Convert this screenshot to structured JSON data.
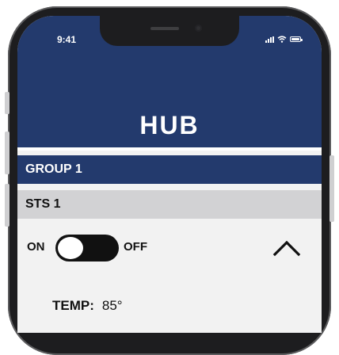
{
  "status_bar": {
    "time": "9:41",
    "icons": [
      "signal-icon",
      "wifi-icon",
      "battery-icon"
    ]
  },
  "header": {
    "title": "HUB",
    "background": "#233a6d"
  },
  "group": {
    "label": "GROUP 1"
  },
  "device": {
    "label": "STS 1"
  },
  "power_toggle": {
    "on_label": "ON",
    "off_label": "OFF",
    "state": "on"
  },
  "collapse_icon": "chevron-up-icon",
  "reading": {
    "label": "TEMP:",
    "value": "85°"
  },
  "colors": {
    "accent": "#233a6d",
    "subheader": "#d2d2d4",
    "toggle_track": "#111111"
  }
}
